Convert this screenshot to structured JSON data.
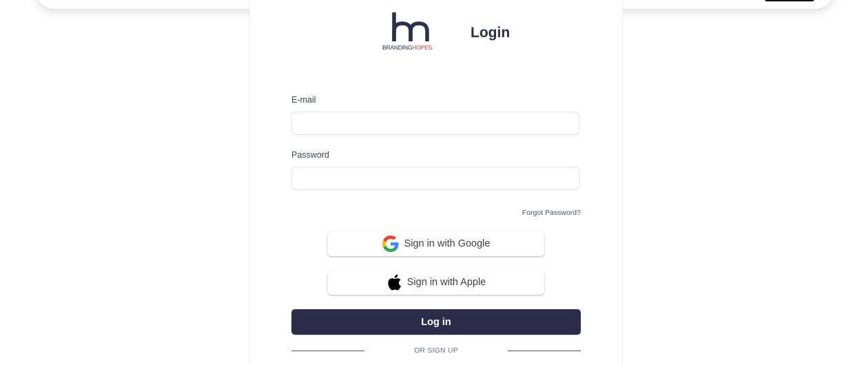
{
  "brand": {
    "logo_name": "BRANDING",
    "logo_accent": "HOPES",
    "accent_color": "#e2372b",
    "primary_color": "#2b2d4a"
  },
  "login": {
    "title": "Login",
    "email_label": "E-mail",
    "email_value": "",
    "password_label": "Password",
    "password_value": "",
    "forgot_label": "Forgot Password?",
    "google_label": "Sign in with Google",
    "google_icon": "google-g-icon",
    "apple_label": "Sign in with Apple",
    "apple_icon": "apple-icon",
    "submit_label": "Log in",
    "divider_label": "OR SIGN UP"
  }
}
